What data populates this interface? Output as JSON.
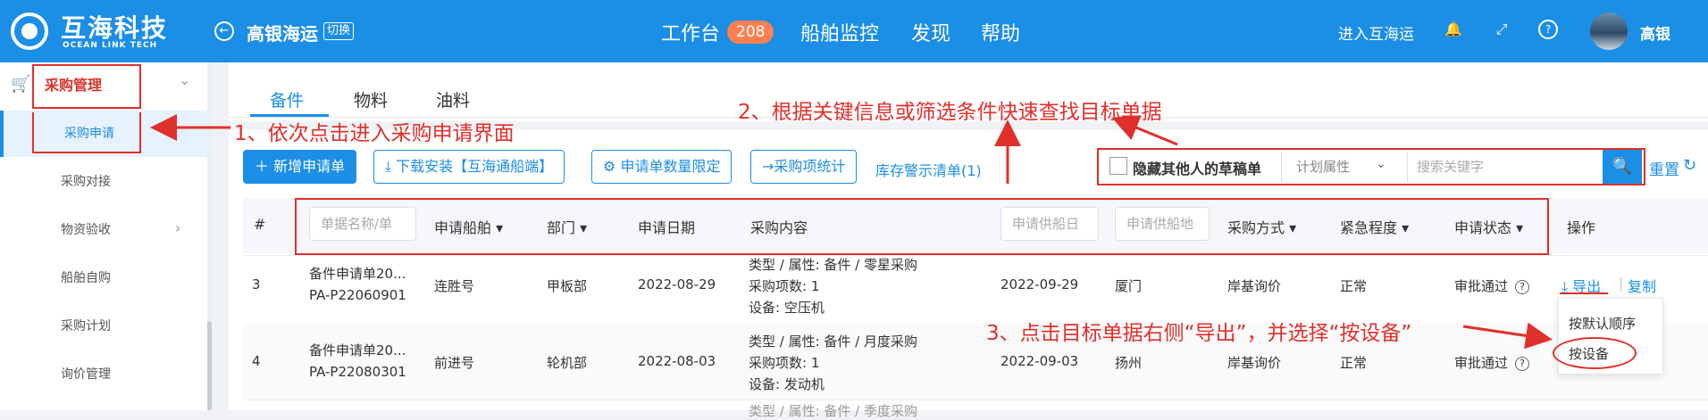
{
  "header": {
    "logo_title": "互海科技",
    "logo_sub": "OCEAN LINK TECH",
    "company": "高银海运",
    "switch_label": "切换",
    "nav": [
      "工作台",
      "船舶监控",
      "发现",
      "帮助"
    ],
    "workbench_badge": "208",
    "enter_label": "进入互海运",
    "user_name": "高银"
  },
  "sidebar": {
    "group_label": "采购管理",
    "items": [
      {
        "label": "采购申请",
        "active": true
      },
      {
        "label": "采购对接"
      },
      {
        "label": "物资验收",
        "has_children": true
      },
      {
        "label": "船舶自购"
      },
      {
        "label": "采购计划"
      },
      {
        "label": "询价管理"
      }
    ]
  },
  "tabs": [
    "备件",
    "物料",
    "油料"
  ],
  "toolbar": {
    "new_label": "新增申请单",
    "download_label": "下载安装【互海通船端】",
    "limit_label": "申请单数量限定",
    "stats_label": "→采购项统计",
    "stock_warning_label": "库存警示清单(1)"
  },
  "search": {
    "hide_drafts_label": "隐藏其他人的草稿单",
    "attr_select": "计划属性",
    "keyword_placeholder": "搜索关键字",
    "reset_label": "重置"
  },
  "table": {
    "headers": {
      "index": "#",
      "name_placeholder": "单据名称/单",
      "ship": "申请船舶",
      "dept": "部门",
      "date": "申请日期",
      "content": "采购内容",
      "supply_date_placeholder": "申请供船日",
      "supply_place_placeholder": "申请供船地",
      "method": "采购方式",
      "urgency": "紧急程度",
      "status": "申请状态",
      "ops": "操作"
    },
    "rows": [
      {
        "index": "3",
        "name": "备件申请单20...",
        "code": "PA-P22060901",
        "ship": "连胜号",
        "dept": "甲板部",
        "date": "2022-08-29",
        "content_type": "类型 / 属性:  备件 / 零星采购",
        "content_count": "采购项数:  1",
        "content_device": "设备:   空压机",
        "supply_date": "2022-09-29",
        "supply_place": "厦门",
        "method": "岸基询价",
        "urgency": "正常",
        "status": "审批通过"
      },
      {
        "index": "4",
        "name": "备件申请单20...",
        "code": "PA-P22080301",
        "ship": "前进号",
        "dept": "轮机部",
        "date": "2022-08-03",
        "content_type": "类型 / 属性:  备件 / 月度采购",
        "content_count": "采购项数:  1",
        "content_device": "设备:   发动机",
        "supply_date": "2022-09-03",
        "supply_place": "扬州",
        "method": "岸基询价",
        "urgency": "正常",
        "status": "审批通过"
      }
    ],
    "partial_row_text": "类型 / 属性:  备件 / 季度采购"
  },
  "ops": {
    "export_label": "导出",
    "copy_label": "复制",
    "dropdown": [
      "按默认顺序",
      "按设备"
    ]
  },
  "annotations": {
    "step1": "1、依次点击进入采购申请界面",
    "step2": "2、根据关键信息或筛选条件快速查找目标单据",
    "step3": "3、点击目标单据右侧“导出”，并选择“按设备”"
  },
  "colors": {
    "primary": "#1b8ee6",
    "annotation_red": "#e0302b",
    "badge": "#ff7f50"
  }
}
